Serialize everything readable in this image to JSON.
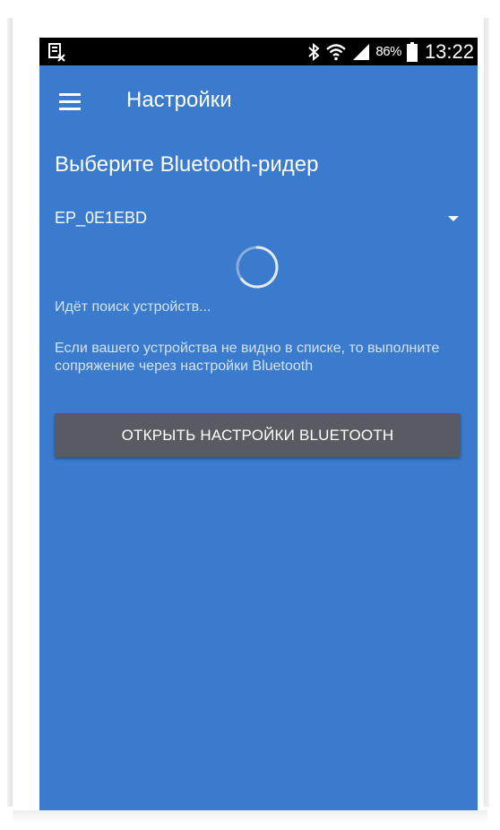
{
  "status_bar": {
    "battery_percent": "86%",
    "time": "13:22",
    "icons": [
      "screenshot-icon",
      "bluetooth-icon",
      "wifi-icon",
      "signal-icon",
      "battery-icon"
    ]
  },
  "app_bar": {
    "title": "Настройки",
    "menu_icon": "hamburger-menu-icon"
  },
  "content": {
    "section_title": "Выберите Bluetooth-ридер",
    "selected_reader": "EP_0E1EBD",
    "searching_text": "Идёт поиск устройств...",
    "hint_text": "Если вашего устройства не видно в списке, то выполните сопряжение через настройки Bluetooth",
    "open_settings_button": "ОТКРЫТЬ НАСТРОЙКИ BLUETOOTH"
  },
  "colors": {
    "background": "#3a7bcd",
    "status_bar": "#000000",
    "button": "#585c62",
    "text": "#ffffff"
  }
}
